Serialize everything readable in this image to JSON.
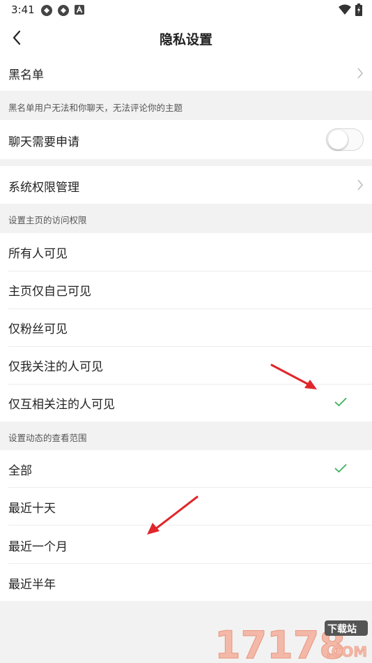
{
  "status": {
    "time": "3:41"
  },
  "header": {
    "title": "隐私设置"
  },
  "blacklist": {
    "label": "黑名单",
    "note": "黑名单用户无法和你聊天，无法评论你的主题"
  },
  "chat_request": {
    "label": "聊天需要申请",
    "enabled": false
  },
  "system_permissions": {
    "label": "系统权限管理"
  },
  "homepage_access": {
    "note": "设置主页的访问权限",
    "options": [
      {
        "label": "所有人可见",
        "selected": false
      },
      {
        "label": "主页仅自己可见",
        "selected": false
      },
      {
        "label": "仅粉丝可见",
        "selected": false
      },
      {
        "label": "仅我关注的人可见",
        "selected": false
      },
      {
        "label": "仅互相关注的人可见",
        "selected": true
      }
    ]
  },
  "feed_range": {
    "note": "设置动态的查看范围",
    "options": [
      {
        "label": "全部",
        "selected": true
      },
      {
        "label": "最近十天",
        "selected": false
      },
      {
        "label": "最近一个月",
        "selected": false
      },
      {
        "label": "最近半年",
        "selected": false
      }
    ]
  },
  "watermark": {
    "text": "17178",
    "badge": "下载站",
    "suffix": ".COM"
  },
  "colors": {
    "accent": "#3cb05a",
    "arrow": "#e0262a"
  }
}
